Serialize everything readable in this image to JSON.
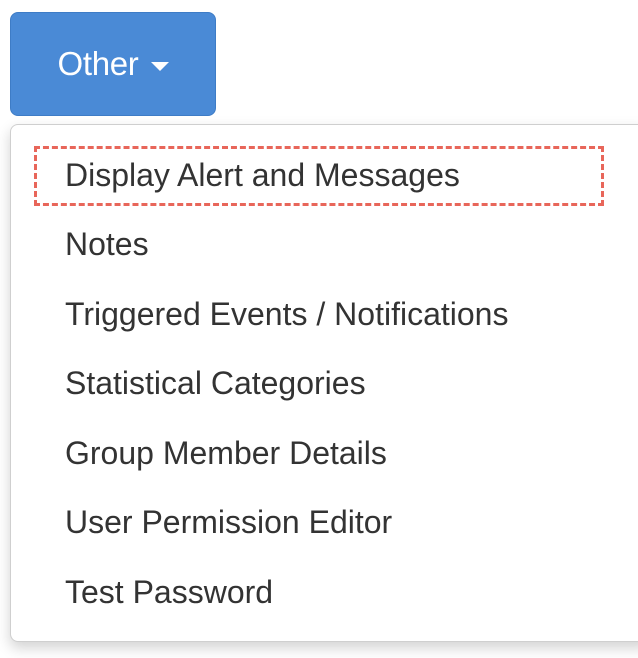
{
  "toggle": {
    "label": "Other",
    "icon": "caret-down-icon"
  },
  "menu": {
    "items": [
      {
        "label": "Display Alert and Messages",
        "highlighted": true
      },
      {
        "label": "Notes"
      },
      {
        "label": "Triggered Events / Notifications"
      },
      {
        "label": "Statistical Categories"
      },
      {
        "label": "Group Member Details"
      },
      {
        "label": "User Permission Editor"
      },
      {
        "label": "Test Password"
      }
    ]
  },
  "colors": {
    "button_bg": "#4a8ad6",
    "text": "#333333",
    "highlight": "#e8665a"
  }
}
